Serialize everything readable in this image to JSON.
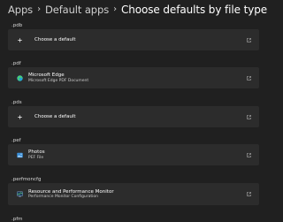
{
  "breadcrumb": {
    "items": [
      "Apps",
      "Default apps"
    ],
    "current": "Choose defaults by file type"
  },
  "sections": [
    {
      "ext": ".pdb",
      "title": "Choose a default",
      "subtitle": "",
      "icon": "plus-icon"
    },
    {
      "ext": ".pdf",
      "title": "Microsoft Edge",
      "subtitle": "Microsoft Edge PDF Document",
      "icon": "edge-icon"
    },
    {
      "ext": ".pds",
      "title": "Choose a default",
      "subtitle": "",
      "icon": "plus-icon"
    },
    {
      "ext": ".pef",
      "title": "Photos",
      "subtitle": "PEF File",
      "icon": "photos-icon"
    },
    {
      "ext": ".perfmoncfg",
      "title": "Resource and Performance Monitor",
      "subtitle": "Performance Monitor Configuration",
      "icon": "perfmon-icon"
    },
    {
      "ext": ".pfm",
      "title": "",
      "subtitle": "",
      "icon": ""
    }
  ],
  "colors": {
    "background": "#202020",
    "card": "#2c2c2c",
    "edge_blue": "#1fa0e3",
    "edge_green": "#4fd06a",
    "photos_blue": "#3a8fd8"
  }
}
